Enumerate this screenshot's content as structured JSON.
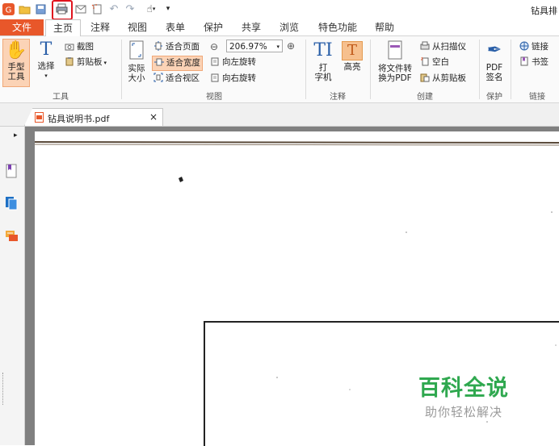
{
  "app": {
    "title_fragment": "钻具排"
  },
  "menu": {
    "tabs": [
      {
        "label": "文件"
      },
      {
        "label": "主页"
      },
      {
        "label": "注释"
      },
      {
        "label": "视图"
      },
      {
        "label": "表单"
      },
      {
        "label": "保护"
      },
      {
        "label": "共享"
      },
      {
        "label": "浏览"
      },
      {
        "label": "特色功能"
      },
      {
        "label": "帮助"
      }
    ]
  },
  "ribbon": {
    "tools": {
      "hand": "手型\n工具",
      "select": "选择",
      "screenshot": "截图",
      "clipboard": "剪贴板",
      "group": "工具"
    },
    "view": {
      "actual_size": "实际\n大小",
      "fit_page": "适合页面",
      "fit_width": "适合宽度",
      "fit_visible": "适合视区",
      "zoom": "206.97%",
      "rotate_left": "向左旋转",
      "rotate_right": "向右旋转",
      "group": "视图"
    },
    "comment": {
      "typewriter": "打\n字机",
      "highlight": "高亮",
      "group": "注释"
    },
    "create": {
      "to_pdf": "将文件转\n换为PDF",
      "from_scanner": "从扫描仪",
      "blank": "空白",
      "from_clipboard": "从剪贴板",
      "group": "创建"
    },
    "protect": {
      "pdf_sign": "PDF\n签名",
      "group": "保护"
    },
    "links": {
      "link": "链接",
      "bookmark": "书签",
      "group": "链接"
    }
  },
  "document": {
    "tab_name": "钻具说明书.pdf"
  },
  "watermark": {
    "title": "百科全说",
    "subtitle": "助你轻松解决"
  },
  "colors": {
    "accent": "#e8572a",
    "highlight_box": "#e0141e",
    "watermark": "#2fa84f"
  }
}
